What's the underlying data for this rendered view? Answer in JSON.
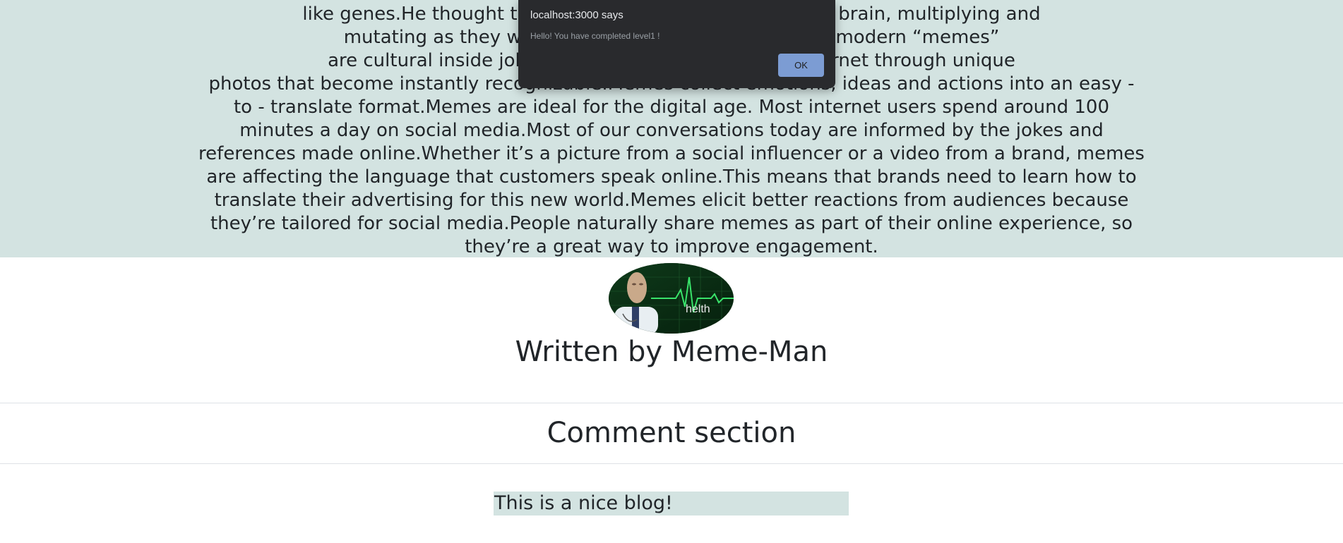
{
  "article": {
    "lines": [
      "like genes.He thought that our ideas spread from brain to brain, multiplying and",
      "mutating as they went.The result was “meme.” Most modern “memes”",
      "are cultural inside jokes.They’re spread across the internet through unique",
      "photos that become instantly recognizable.Memes collect emotions, ideas and actions into an easy -",
      "to - translate format.Memes are ideal for the digital age. Most internet users spend around 100",
      "minutes a day on social media.Most of our conversations today are informed by the jokes and",
      "references made online.Whether it’s a picture from a social influencer or a video from a brand, memes",
      "are affecting the language that customers speak online.This means that brands need to learn how to",
      "translate their advertising for this new world.Memes elicit better reactions from audiences because",
      "they’re tailored for social media.People naturally share memes as part of their online experience, so",
      "they’re a great way to improve engagement."
    ]
  },
  "author": {
    "avatar_caption": "helth",
    "byline": "Written by Meme-Man"
  },
  "comments": {
    "heading": "Comment section",
    "items": [
      "This is a nice blog!"
    ]
  },
  "alert": {
    "title": "localhost:3000 says",
    "message": "Hello! You have completed level1 !",
    "ok_label": "OK"
  },
  "colors": {
    "article_bg": "#d3e3e1",
    "comment_bg": "#d3e3e1",
    "alert_bg": "#292a2d",
    "alert_button": "#7c9cd3",
    "text": "#212529"
  }
}
